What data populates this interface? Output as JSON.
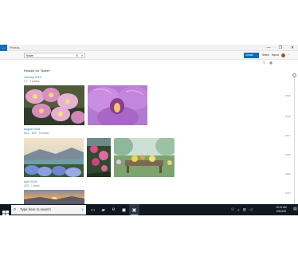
{
  "window": {
    "title": "Photos",
    "controls": [
      "—",
      "❐",
      "✕"
    ]
  },
  "search": {
    "value": "flower",
    "clear_glyph": "✕",
    "go_glyph": "⌕"
  },
  "toolbar": {
    "create_label": "Create",
    "select_label": "Select",
    "import_label": "Import"
  },
  "results": {
    "title": "Results for \"flower\""
  },
  "groups": [
    {
      "date": "January 2019",
      "count": "1/7 · 2 photos"
    },
    {
      "date": "August 2018",
      "count": "8/14 – 8/29 · 3 photos"
    },
    {
      "date": "April 2018",
      "count": "4/23 · 1 photo"
    }
  ],
  "timeline": [
    "2019",
    "2018",
    "2017",
    "2016",
    "2015",
    "2014"
  ],
  "taskbar": {
    "search_placeholder": "Type here to search",
    "time": "10:10 AM",
    "date": "4/5/2019"
  },
  "colors": {
    "accent": "#0f6cbd",
    "taskbar": "#101820",
    "link": "#2a76c6"
  }
}
